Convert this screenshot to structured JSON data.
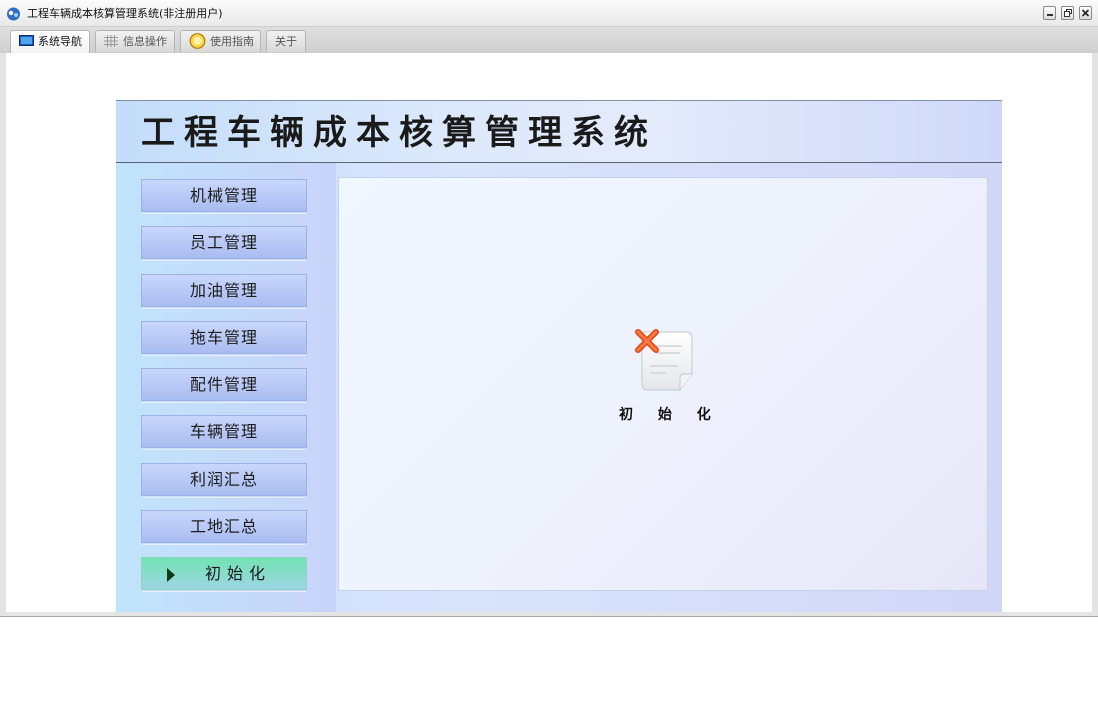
{
  "window": {
    "title": "工程车辆成本核算管理系统(非注册用户)"
  },
  "tabs": [
    {
      "label": "系统导航",
      "icon": "monitor-icon",
      "active": true
    },
    {
      "label": "信息操作",
      "icon": "grid-icon",
      "active": false
    },
    {
      "label": "使用指南",
      "icon": "info-icon",
      "active": false
    },
    {
      "label": "关于",
      "icon": "",
      "active": false
    }
  ],
  "banner": {
    "title": "工程车辆成本核算管理系统"
  },
  "sidebar": {
    "items": [
      {
        "label": "机械管理"
      },
      {
        "label": "员工管理"
      },
      {
        "label": "加油管理"
      },
      {
        "label": "拖车管理"
      },
      {
        "label": "配件管理"
      },
      {
        "label": "车辆管理"
      },
      {
        "label": "利润汇总"
      },
      {
        "label": "工地汇总"
      },
      {
        "label": "初始化",
        "active": true
      }
    ]
  },
  "main": {
    "action_label": "初 始 化",
    "action_icon": "document-delete-icon"
  },
  "colors": {
    "active_nav": "#7fe0b8",
    "nav_button": "#b8c8f6",
    "banner_bg": "#dbe8fb"
  }
}
